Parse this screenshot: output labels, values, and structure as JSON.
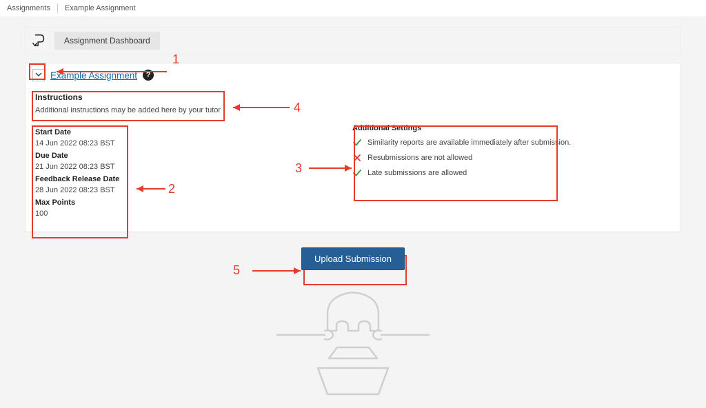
{
  "breadcrumb": {
    "root": "Assignments",
    "current": "Example Assignment"
  },
  "dashboard": {
    "title": "Assignment Dashboard"
  },
  "assignment": {
    "title": "Example Assignment"
  },
  "instructions": {
    "heading": "Instructions",
    "text": "Additional instructions may be added here by your tutor"
  },
  "dates": {
    "start_label": "Start Date",
    "start_val": "14 Jun 2022 08:23 BST",
    "due_label": "Due Date",
    "due_val": "21 Jun 2022 08:23 BST",
    "feedback_label": "Feedback Release Date",
    "feedback_val": "28 Jun 2022 08:23 BST",
    "maxpts_label": "Max Points",
    "maxpts_val": "100"
  },
  "settings": {
    "heading": "Additional Settings",
    "row1": "Similarity reports are available immediately after submission.",
    "row2": "Resubmissions are not allowed",
    "row3": "Late submissions are allowed"
  },
  "actions": {
    "upload_label": "Upload Submission"
  },
  "annotations": {
    "n1": "1",
    "n2": "2",
    "n3": "3",
    "n4": "4",
    "n5": "5"
  }
}
